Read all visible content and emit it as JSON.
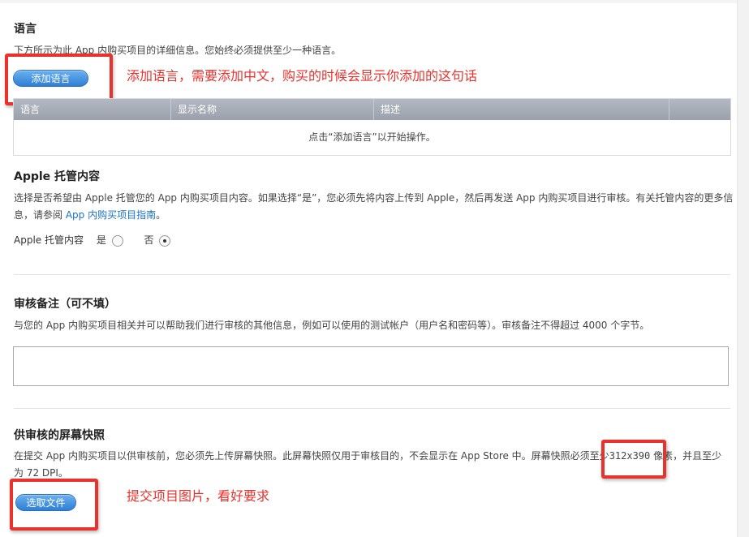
{
  "language": {
    "title": "语言",
    "description": "下方所示为此 App 内购买项目的详细信息。您始终必须提供至少一种语言。",
    "add_button": "添加语言",
    "annotation": "添加语言，需要添加中文，购买的时候会显示你添加的这句话",
    "table": {
      "columns": [
        "语言",
        "显示名称",
        "描述"
      ],
      "empty_message": "点击“添加语言”以开始操作。"
    }
  },
  "hosting": {
    "title": "Apple 托管内容",
    "description_1": "选择是否希望由 Apple 托管您的 App 内购买项目内容。如果选择“是”，您必须先将内容上传到 Apple，然后再发送 App 内购买项目进行审核。有关托管内容的更多信",
    "description_2_prefix": "息，请参阅 ",
    "guide_link": "App 内购买项目指南",
    "description_2_suffix": "。",
    "field_label": "Apple 托管内容",
    "option_yes": "是",
    "option_no": "否",
    "selected": "否"
  },
  "review_notes": {
    "title": "审核备注（可不填）",
    "description": "与您的 App 内购买项目相关并可以帮助我们进行审核的其他信息，例如可以使用的测试帐户（用户名和密码等）。审核备注不得超过 4000 个字节。",
    "value": ""
  },
  "screenshot": {
    "title": "供审核的屏幕快照",
    "description_1_prefix": "在提交 App 内购买项目以供审核前，您必须先上传屏幕快照。此屏幕快照仅用于审核目的，不会显示在 App Store 中。屏幕快照必须至少",
    "size": "312x390",
    "description_1_suffix": " 像素，并且至少",
    "description_2": "为 72 DPI。",
    "choose_button": "选取文件",
    "annotation": "提交项目图片，看好要求"
  },
  "colors": {
    "accent": "#2f7fd6",
    "annotation": "#e8322c",
    "table_header": "#a6adb6"
  }
}
